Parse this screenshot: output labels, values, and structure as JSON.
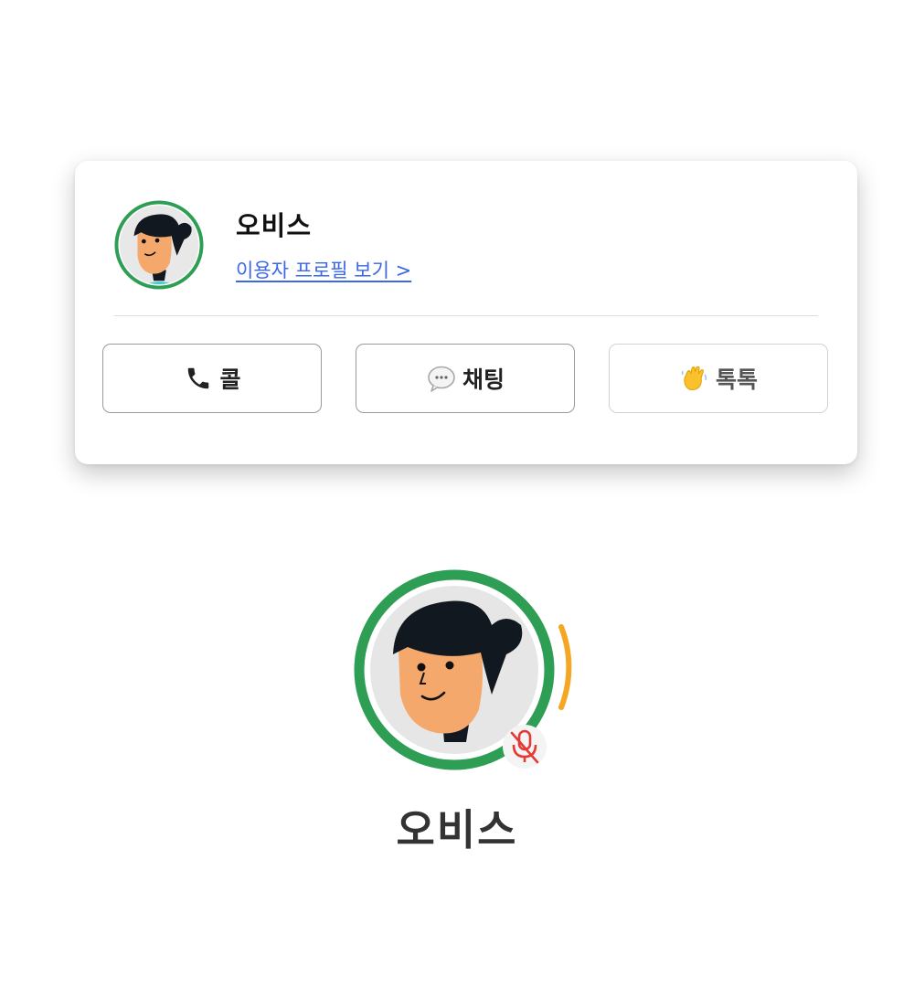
{
  "card": {
    "name": "오비스",
    "profile_link": "이용자 프로필 보기 >",
    "actions": [
      {
        "icon": "phone-icon",
        "label": "콜"
      },
      {
        "icon": "chat-bubble-icon",
        "label": "채팅"
      },
      {
        "icon": "waving-hand-icon",
        "label": "톡톡"
      }
    ]
  },
  "participant": {
    "name": "오비스",
    "status": {
      "speaking_ring_color": "#2e9e55",
      "audio_level_color": "#f5a623",
      "mic": "muted"
    }
  },
  "colors": {
    "link": "#3b67e8",
    "ring": "#2e9e55",
    "mute": "#e53935"
  }
}
